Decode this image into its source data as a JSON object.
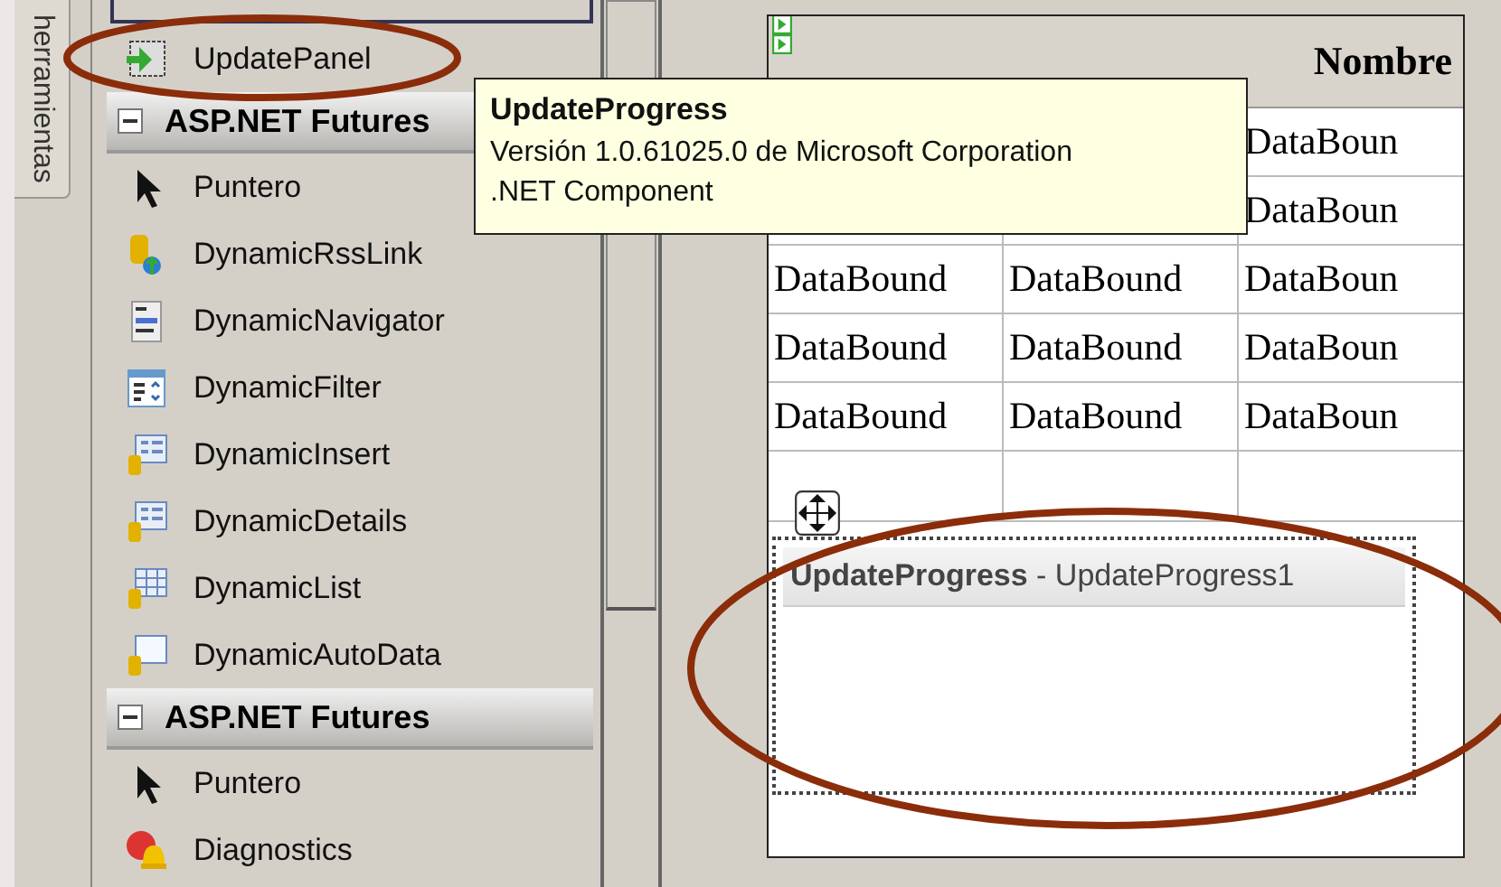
{
  "toolbox": {
    "tab_label": "herramientas",
    "items": [
      {
        "kind": "item",
        "label": "UpdatePanel"
      },
      {
        "kind": "header",
        "label": "ASP.NET Futures",
        "expanded": true
      },
      {
        "kind": "item",
        "label": "Puntero"
      },
      {
        "kind": "item",
        "label": "DynamicRssLink"
      },
      {
        "kind": "item",
        "label": "DynamicNavigator"
      },
      {
        "kind": "item",
        "label": "DynamicFilter"
      },
      {
        "kind": "item",
        "label": "DynamicInsert"
      },
      {
        "kind": "item",
        "label": "DynamicDetails"
      },
      {
        "kind": "item",
        "label": "DynamicList"
      },
      {
        "kind": "item",
        "label": "DynamicAutoData"
      },
      {
        "kind": "header",
        "label": "ASP.NET Futures",
        "expanded": true
      },
      {
        "kind": "item",
        "label": "Puntero"
      },
      {
        "kind": "item",
        "label": "Diagnostics"
      }
    ]
  },
  "tooltip": {
    "title": "UpdateProgress",
    "lines": [
      "Versión 1.0.61025.0 de Microsoft Corporation",
      ".NET Component"
    ]
  },
  "grid": {
    "header": "Nombre",
    "rows": [
      {
        "cells": [
          "DataBoun"
        ]
      },
      {
        "cells": [
          "DataBoun"
        ]
      },
      {
        "cells": [
          "DataBound",
          "DataBound",
          "DataBoun"
        ]
      },
      {
        "cells": [
          "DataBound",
          "DataBound",
          "DataBoun"
        ]
      },
      {
        "cells": [
          "DataBound",
          "DataBound",
          "DataBoun"
        ]
      }
    ]
  },
  "update_progress": {
    "type": "UpdateProgress",
    "id": "- UpdateProgress1"
  }
}
